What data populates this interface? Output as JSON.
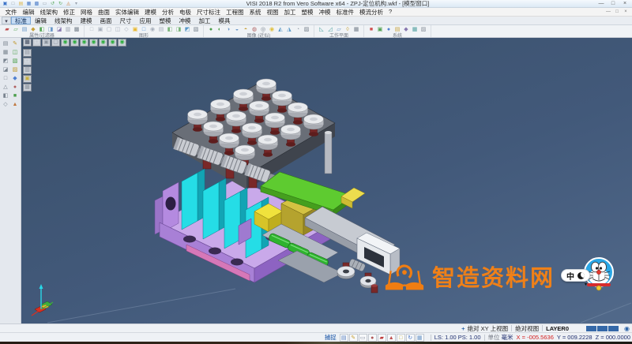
{
  "window": {
    "title": "VISI 2018 R2 from Vero Software x64 - ZPJ-定位机构.wkf - [模型窗口]",
    "controls": {
      "minimize": "—",
      "maximize": "□",
      "close": "×"
    }
  },
  "quick_access": {
    "items": [
      {
        "name": "app-icon",
        "glyph": "▣",
        "color": "#3a72c8"
      },
      {
        "name": "new-file-icon",
        "glyph": "□",
        "color": "#8d959f"
      },
      {
        "name": "open-file-icon",
        "glyph": "▤",
        "color": "#e0b84e"
      },
      {
        "name": "save-icon",
        "glyph": "▦",
        "color": "#4e7ec8"
      },
      {
        "name": "save-all-icon",
        "glyph": "▩",
        "color": "#4e7ec8"
      },
      {
        "name": "print-icon",
        "glyph": "▭",
        "color": "#9aa2ae"
      },
      {
        "name": "undo-icon",
        "glyph": "↺",
        "color": "#58a858"
      },
      {
        "name": "redo-icon",
        "glyph": "↻",
        "color": "#58a858"
      },
      {
        "name": "style-icon",
        "glyph": "◬",
        "color": "#d08848"
      },
      {
        "name": "qa-dropdown-icon",
        "glyph": "▾",
        "color": "#9aa2ae"
      }
    ]
  },
  "menu": {
    "items": [
      "文件",
      "编辑",
      "线架构",
      "修正",
      "网格",
      "曲面",
      "实体编辑",
      "建模",
      "分析",
      "电极",
      "尺寸标注",
      "工程图",
      "系统",
      "视图",
      "加工",
      "塑模",
      "冲模",
      "标准件",
      "模流分析",
      "?"
    ]
  },
  "tabs": {
    "dropdown_glyph": "▾",
    "items": [
      {
        "label": "标准",
        "active": true
      },
      {
        "label": "编辑"
      },
      {
        "label": "线架构"
      },
      {
        "label": "建模"
      },
      {
        "label": "画面"
      },
      {
        "label": "尺寸"
      },
      {
        "label": "应用"
      },
      {
        "label": "塑模"
      },
      {
        "label": "冲模"
      },
      {
        "label": "加工"
      },
      {
        "label": "模具"
      }
    ]
  },
  "toolbar": {
    "groups": [
      {
        "label": "属性/过滤器",
        "icons": [
          {
            "name": "attr-color-icon",
            "glyph": "▰",
            "color": "#c05050"
          },
          {
            "name": "attr-line-icon",
            "glyph": "▱",
            "color": "#58a858"
          },
          {
            "name": "attr-layer-icon",
            "glyph": "▤",
            "color": "#6a96c8"
          },
          {
            "name": "filter-point-icon",
            "glyph": "◆",
            "color": "#c8a23c"
          },
          {
            "name": "filter-curve-icon",
            "glyph": "◧",
            "color": "#58a858"
          },
          {
            "name": "filter-surface-icon",
            "glyph": "◨",
            "color": "#6a96c8"
          },
          {
            "name": "filter-solid-icon",
            "glyph": "◪",
            "color": "#8878b0"
          },
          {
            "name": "filter-mask-icon",
            "glyph": "▥",
            "color": "#9aa2b0"
          },
          {
            "name": "filter-all-icon",
            "glyph": "▩",
            "color": "#78828e"
          }
        ]
      },
      {
        "label": "图形",
        "icons": [
          {
            "name": "redraw-icon",
            "glyph": "□",
            "color": "#a8b0bc"
          },
          {
            "name": "zoom-all-icon",
            "glyph": "▣",
            "color": "#a8b0bc"
          },
          {
            "name": "zoom-window-icon",
            "glyph": "▢",
            "color": "#a8b0bc"
          },
          {
            "name": "zoom-prev-icon",
            "glyph": "◫",
            "color": "#a8b0bc"
          },
          {
            "name": "pan-view-icon",
            "glyph": "◇",
            "color": "#a8b0bc"
          },
          {
            "name": "shaded-view-icon",
            "glyph": "▣",
            "color": "#e8b830"
          },
          {
            "name": "wireframe-view-icon",
            "glyph": "□",
            "color": "#4a90d8"
          },
          {
            "name": "dynamic-rotate-icon",
            "glyph": "◉",
            "color": "#a8b0bc"
          },
          {
            "name": "view-list-icon",
            "glyph": "▤",
            "color": "#a8b0bc"
          },
          {
            "name": "view-split-icon",
            "glyph": "◧",
            "color": "#78b478"
          },
          {
            "name": "view-single-icon",
            "glyph": "◨",
            "color": "#78b478"
          },
          {
            "name": "view-iso-icon",
            "glyph": "◩",
            "color": "#5898c8"
          },
          {
            "name": "view-box-icon",
            "glyph": "▧",
            "color": "#78828e"
          }
        ]
      },
      {
        "label": "图像 (近似)",
        "icons": [
          {
            "name": "render-mode-icon",
            "glyph": "●",
            "color": "#4a9e4a"
          },
          {
            "name": "render-edges-icon",
            "glyph": "◐",
            "color": "#4a9e4a"
          },
          {
            "name": "render-hidden-icon",
            "glyph": "◑",
            "color": "#6a96c8"
          },
          {
            "name": "render-ghost-icon",
            "glyph": "◒",
            "color": "#6a96c8"
          },
          {
            "name": "render-flat-icon",
            "glyph": "◓",
            "color": "#c8a23c"
          },
          {
            "name": "texture-icon",
            "glyph": "◍",
            "color": "#b06060"
          },
          {
            "name": "shadow-icon",
            "glyph": "◎",
            "color": "#78828e"
          },
          {
            "name": "light-icon",
            "glyph": "◉",
            "color": "#e0c040"
          },
          {
            "name": "clip-plane-icon",
            "glyph": "◭",
            "color": "#5898c8"
          },
          {
            "name": "section-icon",
            "glyph": "◮",
            "color": "#5898c8"
          },
          {
            "name": "transparency-icon",
            "glyph": "◔",
            "color": "#9aa2b0"
          },
          {
            "name": "background-icon",
            "glyph": "▨",
            "color": "#78828e"
          }
        ]
      },
      {
        "label": "工作平面",
        "icons": [
          {
            "name": "workplane-xy-icon",
            "glyph": "◺",
            "color": "#4aa0a0"
          },
          {
            "name": "workplane-xz-icon",
            "glyph": "◿",
            "color": "#4aa0a0"
          },
          {
            "name": "workplane-view-icon",
            "glyph": "▱",
            "color": "#6a96c8"
          },
          {
            "name": "workplane-entity-icon",
            "glyph": "◊",
            "color": "#c8a23c"
          },
          {
            "name": "workplane-reset-icon",
            "glyph": "▦",
            "color": "#78828e"
          }
        ]
      },
      {
        "label": "系统",
        "icons": [
          {
            "name": "system-settings-icon",
            "glyph": "■",
            "color": "#d05050"
          },
          {
            "name": "system-database-icon",
            "glyph": "▣",
            "color": "#50a050"
          },
          {
            "name": "system-info-icon",
            "glyph": "●",
            "color": "#5080d0"
          },
          {
            "name": "system-catalog-icon",
            "glyph": "▤",
            "color": "#c8a23c"
          },
          {
            "name": "system-tools-icon",
            "glyph": "◆",
            "color": "#8878b0"
          },
          {
            "name": "system-window-icon",
            "glyph": "▦",
            "color": "#50a0a0"
          },
          {
            "name": "system-help-icon",
            "glyph": "▨",
            "color": "#888f9a"
          }
        ]
      }
    ]
  },
  "left_toolbar": {
    "icons": [
      {
        "name": "select-tool-icon",
        "glyph": "▤",
        "color": "#78828e"
      },
      {
        "name": "sketch-tool-icon",
        "glyph": "✎",
        "color": "#c09a30"
      },
      {
        "name": "trim-tool-icon",
        "glyph": "▦",
        "color": "#78828e"
      },
      {
        "name": "measure-tool-icon",
        "glyph": "◫",
        "color": "#4a9e4a"
      },
      {
        "name": "move-tool-icon",
        "glyph": "◩",
        "color": "#78828e"
      },
      {
        "name": "rotate-tool-icon",
        "glyph": "▧",
        "color": "#4a9e4a"
      },
      {
        "name": "mirror-tool-icon",
        "glyph": "◪",
        "color": "#78828e"
      },
      {
        "name": "scale-tool-icon",
        "glyph": "▨",
        "color": "#c09a30"
      },
      {
        "name": "delete-tool-icon",
        "glyph": "□",
        "color": "#78828e"
      },
      {
        "name": "point-tool-icon",
        "glyph": "◆",
        "color": "#5080d0"
      },
      {
        "name": "line-tool-icon",
        "glyph": "△",
        "color": "#78828e"
      },
      {
        "name": "circle-tool-icon",
        "glyph": "●",
        "color": "#b06060"
      },
      {
        "name": "surface-tool-icon",
        "glyph": "◧",
        "color": "#78828e"
      },
      {
        "name": "solid-tool-icon",
        "glyph": "■",
        "color": "#4a9e4a"
      },
      {
        "name": "feature-tool-icon",
        "glyph": "◇",
        "color": "#78828e"
      },
      {
        "name": "analyze-tool-icon",
        "glyph": "▲",
        "color": "#c07840"
      }
    ]
  },
  "viewport": {
    "colors": {
      "background": "#42597a"
    },
    "top_icons": [
      {
        "name": "viewport-layout-icon",
        "glyph": "▦",
        "color": "#3c465a"
      },
      {
        "name": "view-blank-icon",
        "glyph": "□",
        "color": "#f0f2f6"
      },
      {
        "name": "view-shade-icon",
        "glyph": "▣",
        "color": "#8d959f"
      },
      {
        "name": "view-wire-icon",
        "glyph": "▢",
        "color": "#8d959f"
      },
      {
        "name": "view-orient-top-icon",
        "glyph": "◉",
        "color": "#2fae3e"
      },
      {
        "name": "view-orient-front-icon",
        "glyph": "◉",
        "color": "#2fae3e"
      },
      {
        "name": "view-orient-right-icon",
        "glyph": "◉",
        "color": "#2fae3e"
      },
      {
        "name": "view-orient-left-icon",
        "glyph": "◉",
        "color": "#2fae3e"
      },
      {
        "name": "view-orient-back-icon",
        "glyph": "◉",
        "color": "#2fae3e"
      },
      {
        "name": "view-orient-bottom-icon",
        "glyph": "◉",
        "color": "#2fae3e"
      },
      {
        "name": "view-orient-iso-icon",
        "glyph": "◉",
        "color": "#2fae3e"
      }
    ],
    "side_icons": [
      {
        "name": "vp-doc-icon",
        "glyph": "▤",
        "color": "#8d959f"
      },
      {
        "name": "vp-sheet-icon",
        "glyph": "□",
        "color": "#e8eaf0"
      },
      {
        "name": "vp-layer-icon",
        "glyph": "▥",
        "color": "#8d959f"
      },
      {
        "name": "vp-group-icon",
        "glyph": "▣",
        "color": "#c8b040"
      },
      {
        "name": "vp-prop-icon",
        "glyph": "▦",
        "color": "#8d959f"
      }
    ],
    "watermark": {
      "text": "智造资料网",
      "color": "#ef8018"
    },
    "ime": {
      "label": "中"
    }
  },
  "status_upper": {
    "cursor_glyph": "+",
    "view_plane": "绝对 XY 上视图",
    "view_mode": "绝对视图",
    "layer": "LAYER0"
  },
  "status_lower": {
    "snap": "捕捉",
    "icons": [
      {
        "name": "status-notes-icon",
        "glyph": "▤",
        "color": "#5a80c0"
      },
      {
        "name": "status-pen-icon",
        "glyph": "✎",
        "color": "#c8a23c"
      },
      {
        "name": "status-ruler-icon",
        "glyph": "▭",
        "color": "#8890a0"
      },
      {
        "name": "status-user-icon",
        "glyph": "●",
        "color": "#b05858"
      },
      {
        "name": "status-truck-icon",
        "glyph": "▰",
        "color": "#c04040"
      },
      {
        "name": "status-flag-icon",
        "glyph": "▲",
        "color": "#c05050"
      },
      {
        "name": "status-doc-icon",
        "glyph": "□",
        "color": "#c8b040"
      },
      {
        "name": "status-refresh-icon",
        "glyph": "↻",
        "color": "#4a78c8"
      },
      {
        "name": "status-grid-icon",
        "glyph": "▦",
        "color": "#6a96c8"
      }
    ],
    "scale": "LS: 1.00 PS: 1.00",
    "units_label": "单位",
    "units_value": "毫米",
    "x": "X = -005.5636",
    "y": "Y = 009.2228",
    "z": "Z = 000.0000"
  }
}
